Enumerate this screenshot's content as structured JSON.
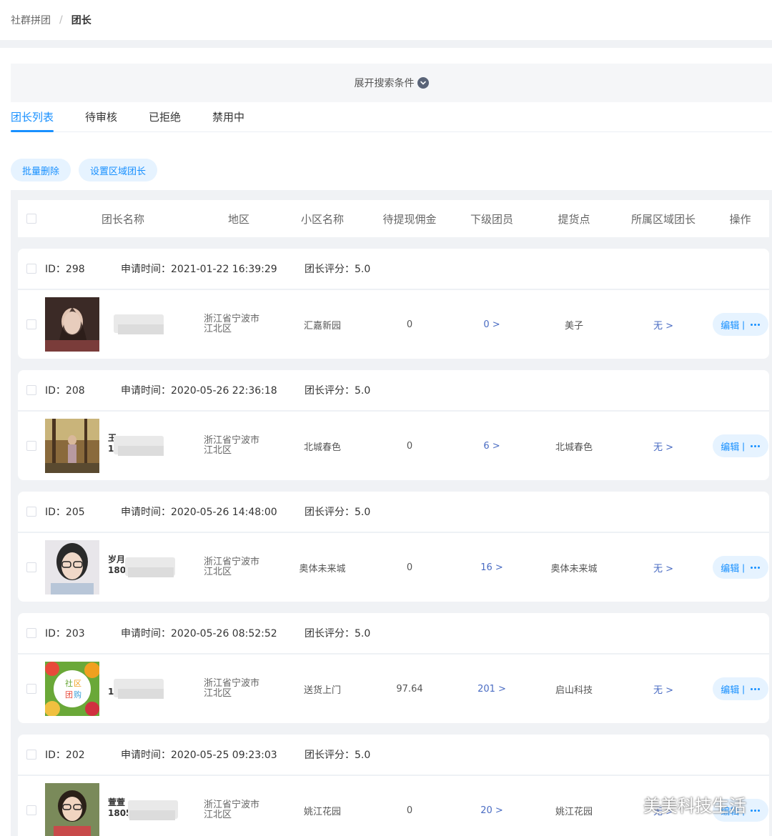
{
  "breadcrumb": {
    "root": "社群拼团",
    "separator": "/",
    "current": "团长"
  },
  "search": {
    "toggle_label": "展开搜索条件"
  },
  "tabs": [
    {
      "label": "团长列表",
      "active": true
    },
    {
      "label": "待审核",
      "active": false
    },
    {
      "label": "已拒绝",
      "active": false
    },
    {
      "label": "禁用中",
      "active": false
    }
  ],
  "toolbar": {
    "batch_delete_label": "批量删除",
    "set_region_leader_label": "设置区域团长"
  },
  "columns": [
    "团长名称",
    "地区",
    "小区名称",
    "待提现佣金",
    "下级团员",
    "提货点",
    "所属区域团长",
    "操作"
  ],
  "labels": {
    "id_prefix": "ID：",
    "apply_prefix": "申请时间：",
    "score_prefix": "团长评分：",
    "edit": "编辑",
    "divider": "|"
  },
  "rows": [
    {
      "id": "298",
      "apply_time": "2021-01-22 16:39:29",
      "score": "5.0",
      "name_visible": "",
      "phone_visible": "",
      "region_line1": "浙江省宁波市",
      "region_line2": "江北区",
      "community": "汇嘉新园",
      "commission": "0",
      "members": "0 >",
      "pickup": "美子",
      "region_leader": "无 >"
    },
    {
      "id": "208",
      "apply_time": "2020-05-26 22:36:18",
      "score": "5.0",
      "name_visible": "王",
      "phone_visible": "1",
      "region_line1": "浙江省宁波市",
      "region_line2": "江北区",
      "community": "北城春色",
      "commission": "0",
      "members": "6 >",
      "pickup": "北城春色",
      "region_leader": "无 >"
    },
    {
      "id": "205",
      "apply_time": "2020-05-26 14:48:00",
      "score": "5.0",
      "name_visible": "岁月",
      "phone_visible": "1806",
      "region_line1": "浙江省宁波市",
      "region_line2": "江北区",
      "community": "奥体未来城",
      "commission": "0",
      "members": "16 >",
      "pickup": "奥体未来城",
      "region_leader": "无 >"
    },
    {
      "id": "203",
      "apply_time": "2020-05-26 08:52:52",
      "score": "5.0",
      "name_visible": "",
      "phone_visible": "1",
      "region_line1": "浙江省宁波市",
      "region_line2": "江北区",
      "community": "送货上门",
      "commission": "97.64",
      "members": "201 >",
      "pickup": "启山科技",
      "region_leader": "无 >"
    },
    {
      "id": "202",
      "apply_time": "2020-05-25 09:23:03",
      "score": "5.0",
      "name_visible": "萱萱",
      "phone_visible": "1805",
      "region_line1": "浙江省宁波市",
      "region_line2": "江北区",
      "community": "姚江花园",
      "commission": "0",
      "members": "20 >",
      "pickup": "姚江花园",
      "region_leader": "无 >"
    }
  ],
  "watermark": {
    "text": "美美科技生活"
  },
  "colors": {
    "accent": "#1890ff",
    "pill_bg": "#e6f3ff",
    "page_bg": "#f0f2f5",
    "link": "#4a6cc3"
  }
}
